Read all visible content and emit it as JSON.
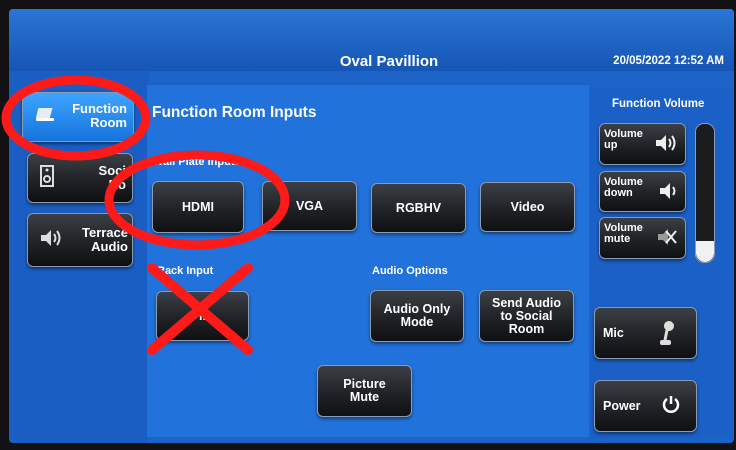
{
  "header": {
    "title": "Oval Pavillion",
    "datetime": "20/05/2022 12:52 AM"
  },
  "sidebar": {
    "items": [
      {
        "label_line1": "Function",
        "label_line2": "Room",
        "icon": "laptop-icon",
        "active": true
      },
      {
        "label_line1": "Soci",
        "label_line2": "Ro",
        "icon": "speaker-box-icon",
        "active": false
      },
      {
        "label_line1": "Terrace",
        "label_line2": "Audio",
        "icon": "speaker-volume-icon",
        "active": false
      }
    ]
  },
  "main": {
    "heading": "Function Room Inputs",
    "wall_plate_label": "Wall Plate Inputs",
    "inputs": [
      "HDMI",
      "VGA",
      "RGBHV",
      "Video"
    ],
    "rack_label": "Rack Input",
    "rack_button": "ll",
    "audio_options_label": "Audio Options",
    "audio_only_line1": "Audio Only",
    "audio_only_line2": "Mode",
    "send_audio_line1": "Send Audio",
    "send_audio_line2": "to Social",
    "send_audio_line3": "Room",
    "picture_mute_line1": "Picture",
    "picture_mute_line2": "Mute"
  },
  "volume": {
    "heading": "Function Volume",
    "up_line1": "Volume",
    "up_line2": "up",
    "down_line1": "Volume",
    "down_line2": "down",
    "mute_line1": "Volume",
    "mute_line2": "mute",
    "level": 0.15
  },
  "mic_label": "Mic",
  "power_label": "Power",
  "colors": {
    "screen_bg": "#1c63c8",
    "active_button": "#1e8cf0",
    "annotation_red": "#ff1a1a"
  }
}
